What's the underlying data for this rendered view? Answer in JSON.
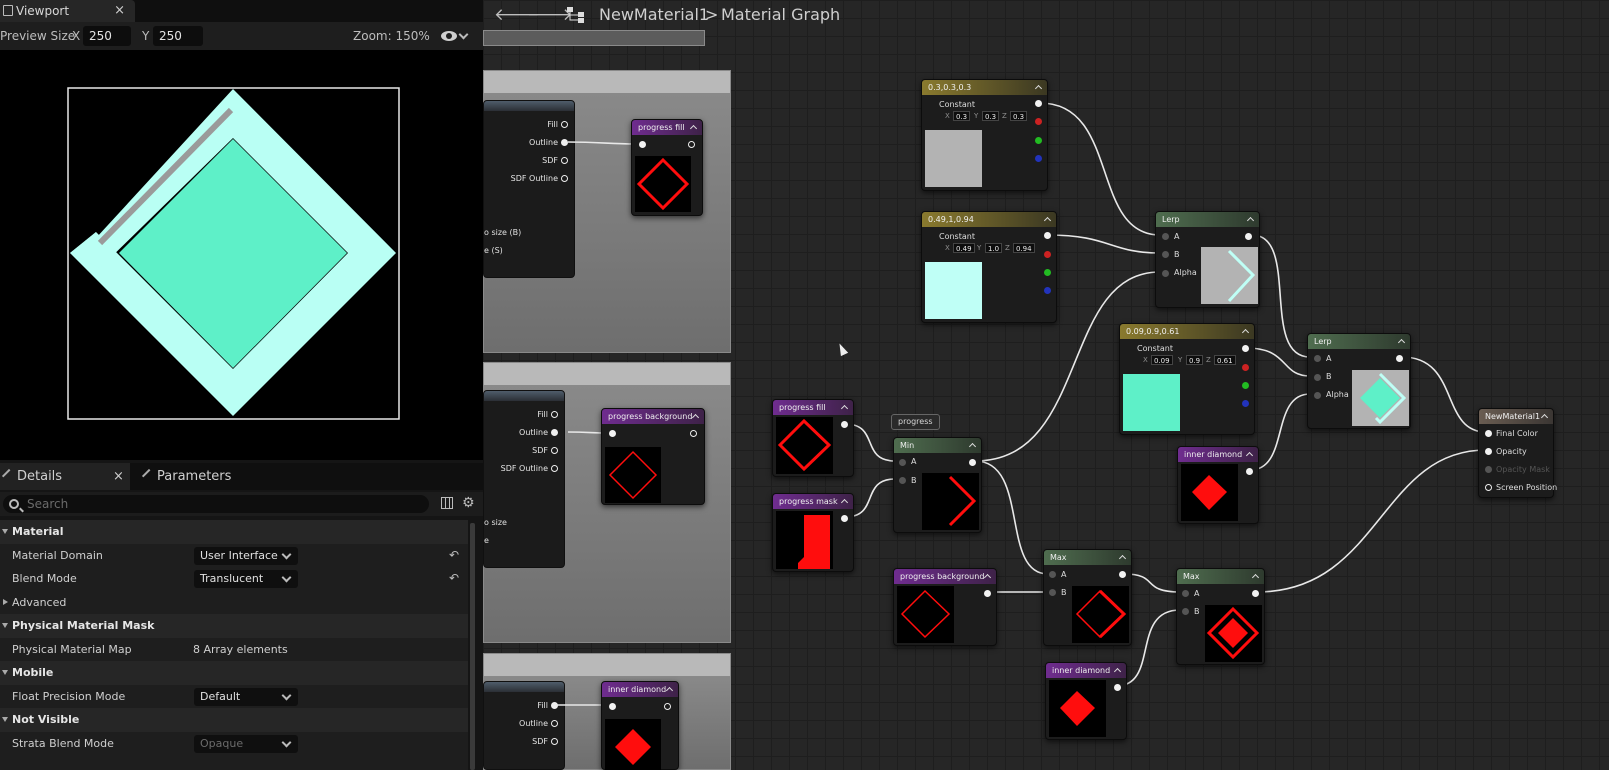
{
  "viewport": {
    "tab_title": "Viewport",
    "close": "×",
    "preview_size_label": "Preview Size",
    "x_label": "X",
    "x_value": "250",
    "y_label": "Y",
    "y_value": "250",
    "zoom": "Zoom: 150%",
    "colors": {
      "fill": "#5ef0c8",
      "outline": "#b9fff4",
      "progress": "#9a9a9a"
    }
  },
  "details": {
    "tab_details": "Details",
    "tab_parameters": "Parameters",
    "search_placeholder": "Search",
    "rows": [
      {
        "label": "Material",
        "type": "category"
      },
      {
        "label": "Material Domain",
        "value": "User Interface",
        "type": "dropdown",
        "reset": true
      },
      {
        "label": "Blend Mode",
        "value": "Translucent",
        "type": "dropdown",
        "reset": true
      },
      {
        "label": "Advanced",
        "type": "subgroup"
      },
      {
        "label": "Physical Material Mask",
        "type": "category"
      },
      {
        "label": "Physical Material Map",
        "value": "8 Array elements",
        "type": "text"
      },
      {
        "label": "Mobile",
        "type": "category"
      },
      {
        "label": "Float Precision Mode",
        "value": "Default",
        "type": "dropdown"
      },
      {
        "label": "Not Visible",
        "type": "category"
      },
      {
        "label": "Strata Blend Mode",
        "value": "Opaque",
        "type": "dropdown-disabled"
      }
    ]
  },
  "graph": {
    "breadcrumb_asset": "NewMaterial1",
    "breadcrumb_sep": ">",
    "breadcrumb_graph": "Material Graph",
    "sdf_pins": {
      "fill": "Fill",
      "outline": "Outline",
      "sdf": "SDF",
      "sdf_outline": "SDF Outline"
    },
    "sdf_left_a": "o size (B)",
    "sdf_left_b": "e (S)",
    "sdf_left_c": "o size",
    "sdf_left_d": "e",
    "nodes": {
      "progress_fill_1": "progress fill",
      "progress_background_1": "progress background",
      "inner_diamond_1": "inner diamond",
      "const1_title": "0.3,0.3,0.3",
      "const1_label": "Constant",
      "const1_values": [
        "0.3",
        "0.3",
        "0.3"
      ],
      "const2_title": "0.49,1,0.94",
      "const2_label": "Constant",
      "const2_values": [
        "0.49",
        "1.0",
        "0.94"
      ],
      "const3_title": "0.09,0.9,0.61",
      "const3_label": "Constant",
      "const3_values": [
        "0.09",
        "0.9",
        "0.61"
      ],
      "lerp1": "Lerp",
      "lerp2": "Lerp",
      "lerp_a": "A",
      "lerp_b": "B",
      "lerp_alpha": "Alpha",
      "progress_fill_2": "progress fill",
      "progress_mask": "progress mask",
      "progress_tag": "progress",
      "min": "Min",
      "max1": "Max",
      "max2": "Max",
      "progress_background_2": "progress background",
      "inner_diamond_2": "inner diamond",
      "inner_diamond_3": "inner diamond",
      "output": "NewMaterial1",
      "out_final_color": "Final Color",
      "out_opacity": "Opacity",
      "out_opacity_mask": "Opacity Mask",
      "out_screen_position": "Screen Position"
    },
    "axes": {
      "x": "X",
      "y": "Y",
      "z": "Z"
    },
    "colors": {
      "const1": "#b3b3b3",
      "const2": "#bffff6",
      "const3": "#5ef0c8",
      "red": "#ff0d0d"
    }
  }
}
